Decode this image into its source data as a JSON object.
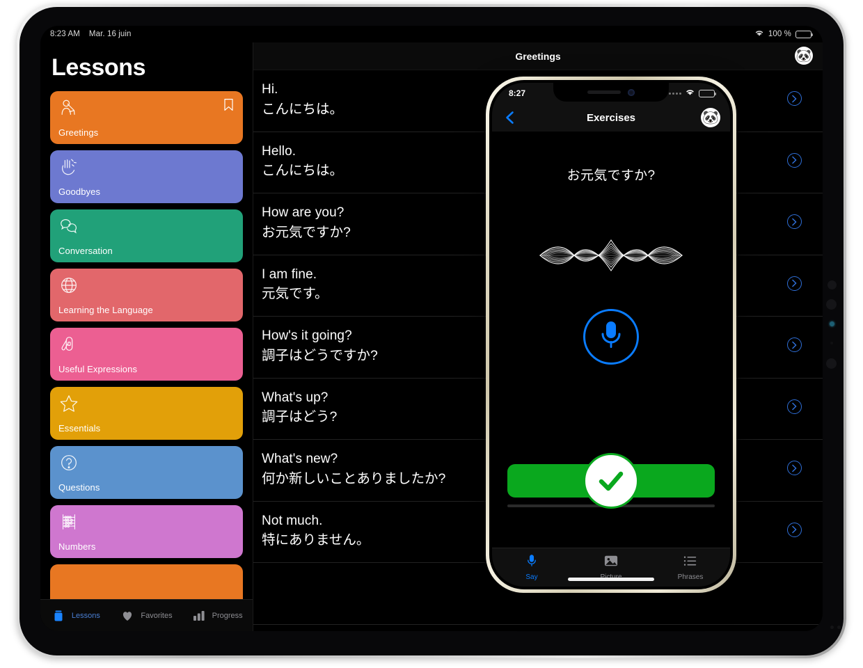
{
  "ipad": {
    "status_bar": {
      "time": "8:23 AM",
      "date": "Mar. 16 juin",
      "battery_percent": "100 %",
      "wifi_icon": "wifi-icon",
      "battery_icon": "battery-full-icon"
    },
    "sidebar": {
      "title": "Lessons",
      "items": [
        {
          "label": "Greetings",
          "color": "#e87722",
          "icon": "greeting-person-icon",
          "bookmarked": true
        },
        {
          "label": "Goodbyes",
          "color": "#6d79d0",
          "icon": "waving-hand-icon",
          "bookmarked": false
        },
        {
          "label": "Conversation",
          "color": "#21a179",
          "icon": "speech-bubbles-icon",
          "bookmarked": false
        },
        {
          "label": "Learning the Language",
          "color": "#e2676b",
          "icon": "globe-icon",
          "bookmarked": false
        },
        {
          "label": "Useful Expressions",
          "color": "#ec5f92",
          "icon": "swiss-army-knife-icon",
          "bookmarked": false
        },
        {
          "label": "Essentials",
          "color": "#e2a009",
          "icon": "star-icon",
          "bookmarked": false
        },
        {
          "label": "Questions",
          "color": "#5b92cd",
          "icon": "question-mark-icon",
          "bookmarked": false
        },
        {
          "label": "Numbers",
          "color": "#cf77cf",
          "icon": "abacus-icon",
          "bookmarked": false
        },
        {
          "label": "",
          "color": "#e87722",
          "icon": "",
          "bookmarked": false
        }
      ]
    },
    "tabs": [
      {
        "label": "Lessons",
        "icon": "book-stack-icon",
        "active": true
      },
      {
        "label": "Favorites",
        "icon": "heart-icon",
        "active": false
      },
      {
        "label": "Progress",
        "icon": "bar-chart-icon",
        "active": false
      }
    ],
    "detail": {
      "title": "Greetings",
      "avatar_icon": "panda-avatar",
      "avatar_glyph": "🐼",
      "row_action_icon": "chevron-right-circle-icon",
      "phrases": [
        {
          "en": "Hi.",
          "ja": "こんにちは。"
        },
        {
          "en": "Hello.",
          "ja": "こんにちは。"
        },
        {
          "en": "How are you?",
          "ja": "お元気ですか?"
        },
        {
          "en": "I am fine.",
          "ja": "元気です。"
        },
        {
          "en": "How's it going?",
          "ja": "調子はどうですか?"
        },
        {
          "en": "What's up?",
          "ja": "調子はどう?"
        },
        {
          "en": "What's new?",
          "ja": "何か新しいことありましたか?"
        },
        {
          "en": "Not much.",
          "ja": "特にありません。"
        },
        {
          "en": "",
          "ja": ""
        }
      ]
    }
  },
  "iphone": {
    "status_bar": {
      "time": "8:27",
      "signal_icon": "signal-dots-icon",
      "wifi_icon": "wifi-icon",
      "battery_icon": "battery-full-icon"
    },
    "nav": {
      "back_icon": "chevron-left-icon",
      "title": "Exercises",
      "avatar_icon": "panda-avatar",
      "avatar_glyph": "🐼"
    },
    "exercise": {
      "prompt": "お元気ですか?",
      "waveform_icon": "siri-waveform-icon",
      "mic_icon": "microphone-icon",
      "confirm_icon": "check-circle-icon"
    },
    "tabs": [
      {
        "label": "Say",
        "icon": "microphone-icon",
        "active": true
      },
      {
        "label": "Picture",
        "icon": "photo-icon",
        "active": false
      },
      {
        "label": "Phrases",
        "icon": "list-icon",
        "active": false
      }
    ]
  },
  "colors": {
    "ios_blue": "#0a7cff",
    "confirm_green": "#0aa81e",
    "tab_inactive": "#8e8e93"
  }
}
